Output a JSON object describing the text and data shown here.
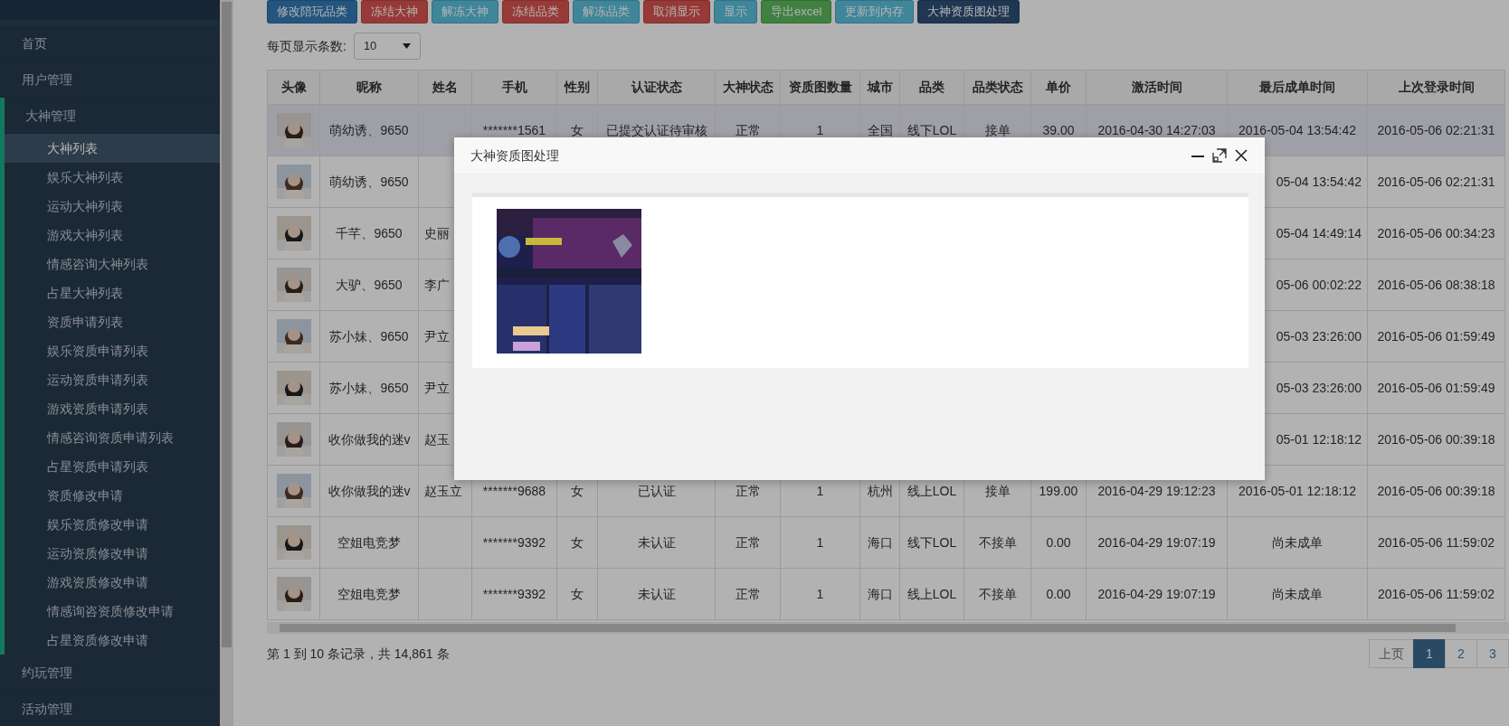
{
  "sidebar": {
    "items": [
      {
        "label": "首页",
        "expanded": false
      },
      {
        "label": "用户管理",
        "expanded": false
      },
      {
        "label": "大神管理",
        "expanded": true,
        "children": [
          {
            "label": "大神列表",
            "selected": true
          },
          {
            "label": "娱乐大神列表",
            "selected": false
          },
          {
            "label": "运动大神列表",
            "selected": false
          },
          {
            "label": "游戏大神列表",
            "selected": false
          },
          {
            "label": "情感咨询大神列表",
            "selected": false
          },
          {
            "label": "占星大神列表",
            "selected": false
          },
          {
            "label": "资质申请列表",
            "selected": false
          },
          {
            "label": "娱乐资质申请列表",
            "selected": false
          },
          {
            "label": "运动资质申请列表",
            "selected": false
          },
          {
            "label": "游戏资质申请列表",
            "selected": false
          },
          {
            "label": "情感咨询资质申请列表",
            "selected": false
          },
          {
            "label": "占星资质申请列表",
            "selected": false
          },
          {
            "label": "资质修改申请",
            "selected": false
          },
          {
            "label": "娱乐资质修改申请",
            "selected": false
          },
          {
            "label": "运动资质修改申请",
            "selected": false
          },
          {
            "label": "游戏资质修改申请",
            "selected": false
          },
          {
            "label": "情感询咨资质修改申请",
            "selected": false
          },
          {
            "label": "占星资质修改申请",
            "selected": false
          }
        ]
      },
      {
        "label": "约玩管理",
        "expanded": false
      },
      {
        "label": "活动管理",
        "expanded": false
      }
    ]
  },
  "toolbar": {
    "buttons": [
      {
        "label": "修改陪玩品类",
        "kind": "primary"
      },
      {
        "label": "冻结大神",
        "kind": "danger"
      },
      {
        "label": "解冻大神",
        "kind": "info"
      },
      {
        "label": "冻结品类",
        "kind": "danger"
      },
      {
        "label": "解冻品类",
        "kind": "info"
      },
      {
        "label": "取消显示",
        "kind": "danger"
      },
      {
        "label": "显示",
        "kind": "info"
      },
      {
        "label": "导出excel",
        "kind": "success"
      },
      {
        "label": "更新到内存",
        "kind": "info"
      },
      {
        "label": "大神资质图处理",
        "kind": "navy"
      }
    ]
  },
  "page_size": {
    "label": "每页显示条数:",
    "value": "10"
  },
  "table": {
    "columns": [
      "头像",
      "昵称",
      "姓名",
      "手机",
      "性别",
      "认证状态",
      "大神状态",
      "资质图数量",
      "城市",
      "品类",
      "品类状态",
      "单价",
      "激活时间",
      "最后成单时间",
      "上次登录时间"
    ],
    "rows": [
      {
        "selected": true,
        "cells": [
          "",
          "萌幼诱、9650",
          null,
          "*******1561",
          "女",
          "已提交认证待审核",
          "正常",
          "1",
          "全国",
          "线下LOL",
          "接单",
          "39.00",
          "2016-04-30 14:27:03",
          "2016-05-04 13:54:42",
          "2016-05-06 02:21:31"
        ]
      },
      {
        "selected": false,
        "cells": [
          "",
          "萌幼诱、9650",
          null,
          null,
          null,
          null,
          null,
          null,
          null,
          null,
          null,
          null,
          null,
          "05-04 13:54:42",
          "2016-05-06 02:21:31"
        ]
      },
      {
        "selected": false,
        "cells": [
          "",
          "千芊、9650",
          "史丽",
          null,
          null,
          null,
          null,
          null,
          null,
          null,
          null,
          null,
          null,
          "05-04 14:49:14",
          "2016-05-06 00:34:23"
        ]
      },
      {
        "selected": false,
        "cells": [
          "",
          "大驴、9650",
          "李广",
          null,
          null,
          null,
          null,
          null,
          null,
          null,
          null,
          null,
          null,
          "05-06 00:02:22",
          "2016-05-06 08:38:18"
        ]
      },
      {
        "selected": false,
        "cells": [
          "",
          "苏小妹、9650",
          "尹立",
          null,
          null,
          null,
          null,
          null,
          null,
          null,
          null,
          null,
          null,
          "05-03 23:26:00",
          "2016-05-06 01:59:49"
        ]
      },
      {
        "selected": false,
        "cells": [
          "",
          "苏小妹、9650",
          "尹立",
          null,
          null,
          null,
          null,
          null,
          null,
          null,
          null,
          null,
          null,
          "05-03 23:26:00",
          "2016-05-06 01:59:49"
        ]
      },
      {
        "selected": false,
        "cells": [
          "",
          "收你做我的迷v",
          "赵玉",
          null,
          null,
          null,
          null,
          null,
          null,
          null,
          null,
          null,
          null,
          "05-01 12:18:12",
          "2016-05-06 00:39:18"
        ]
      },
      {
        "selected": false,
        "cells": [
          "",
          "收你做我的迷v",
          "赵玉立",
          "*******9688",
          "女",
          "已认证",
          "正常",
          "1",
          "杭州",
          "线上LOL",
          "接单",
          "199.00",
          "2016-04-29 19:12:23",
          "2016-05-01 12:18:12",
          "2016-05-06 00:39:18"
        ]
      },
      {
        "selected": false,
        "cells": [
          "",
          "空姐电竞梦",
          null,
          "*******9392",
          "女",
          "未认证",
          "正常",
          "1",
          "海口",
          "线下LOL",
          "不接单",
          "0.00",
          "2016-04-29 19:07:19",
          "尚未成单",
          "2016-05-06 11:59:02"
        ]
      },
      {
        "selected": false,
        "cells": [
          "",
          "空姐电竞梦",
          null,
          "*******9392",
          "女",
          "未认证",
          "正常",
          "1",
          "海口",
          "线上LOL",
          "不接单",
          "0.00",
          "2016-04-29 19:07:19",
          "尚未成单",
          "2016-05-06 11:59:02"
        ]
      }
    ]
  },
  "footer": {
    "summary": "第 1 到 10 条记录，共 14,861 条"
  },
  "pagination": [
    {
      "label": "上页",
      "selected": false
    },
    {
      "label": "1",
      "selected": true
    },
    {
      "label": "2",
      "selected": false
    },
    {
      "label": "3",
      "selected": false
    }
  ],
  "dialog": {
    "title": "大神资质图处理"
  }
}
